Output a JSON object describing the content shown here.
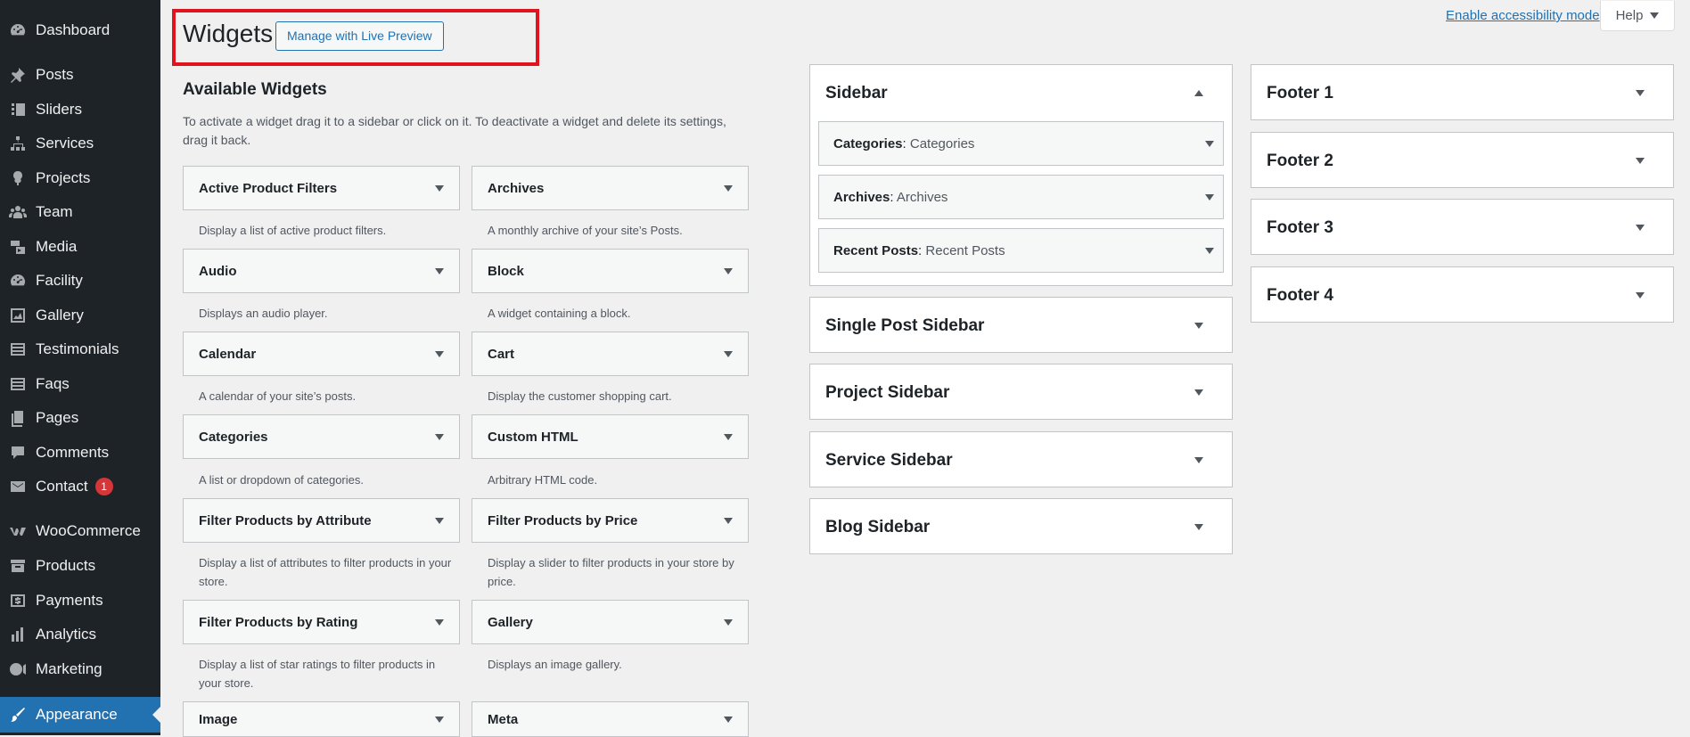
{
  "sidebar": {
    "items": [
      {
        "label": "Dashboard",
        "icon": "dashboard-icon"
      },
      {
        "label": "Posts",
        "icon": "pin-icon"
      },
      {
        "label": "Sliders",
        "icon": "slides-icon"
      },
      {
        "label": "Services",
        "icon": "sitemap-icon"
      },
      {
        "label": "Projects",
        "icon": "tree-icon"
      },
      {
        "label": "Team",
        "icon": "groups-icon"
      },
      {
        "label": "Media",
        "icon": "media-icon"
      },
      {
        "label": "Facility",
        "icon": "dashboard-icon"
      },
      {
        "label": "Gallery",
        "icon": "chart-icon"
      },
      {
        "label": "Testimonials",
        "icon": "list-icon"
      },
      {
        "label": "Faqs",
        "icon": "list-icon"
      },
      {
        "label": "Pages",
        "icon": "pages-icon"
      },
      {
        "label": "Comments",
        "icon": "comment-icon"
      },
      {
        "label": "Contact",
        "icon": "mail-icon",
        "badge": "1"
      },
      {
        "label": "WooCommerce",
        "icon": "woo-icon"
      },
      {
        "label": "Products",
        "icon": "archive-icon"
      },
      {
        "label": "Payments",
        "icon": "dollar-icon"
      },
      {
        "label": "Analytics",
        "icon": "bar-chart-icon"
      },
      {
        "label": "Marketing",
        "icon": "megaphone-icon"
      },
      {
        "label": "Appearance",
        "icon": "brush-icon",
        "current": true
      }
    ]
  },
  "header": {
    "title": "Widgets",
    "live_preview_label": "Manage with Live Preview",
    "accessibility_link": "Enable accessibility mode",
    "help_label": "Help"
  },
  "available": {
    "title": "Available Widgets",
    "description": "To activate a widget drag it to a sidebar or click on it. To deactivate a widget and delete its settings, drag it back.",
    "widgets": [
      {
        "name": "Active Product Filters",
        "desc": "Display a list of active product filters."
      },
      {
        "name": "Archives",
        "desc": "A monthly archive of your site’s Posts."
      },
      {
        "name": "Audio",
        "desc": "Displays an audio player."
      },
      {
        "name": "Block",
        "desc": "A widget containing a block."
      },
      {
        "name": "Calendar",
        "desc": "A calendar of your site’s posts."
      },
      {
        "name": "Cart",
        "desc": "Display the customer shopping cart."
      },
      {
        "name": "Categories",
        "desc": "A list or dropdown of categories."
      },
      {
        "name": "Custom HTML",
        "desc": "Arbitrary HTML code."
      },
      {
        "name": "Filter Products by Attribute",
        "desc": "Display a list of attributes to filter products in your store."
      },
      {
        "name": "Filter Products by Price",
        "desc": "Display a slider to filter products in your store by price."
      },
      {
        "name": "Filter Products by Rating",
        "desc": "Display a list of star ratings to filter products in your store."
      },
      {
        "name": "Gallery",
        "desc": "Displays an image gallery."
      },
      {
        "name": "Image",
        "desc": ""
      },
      {
        "name": "Meta",
        "desc": ""
      }
    ]
  },
  "areas": {
    "sidebar": {
      "title": "Sidebar",
      "widgets": [
        {
          "name": "Categories",
          "sep": ": ",
          "title": "Categories"
        },
        {
          "name": "Archives",
          "sep": ": ",
          "title": "Archives"
        },
        {
          "name": "Recent Posts",
          "sep": ": ",
          "title": "Recent Posts"
        }
      ]
    },
    "single_post": {
      "title": "Single Post Sidebar"
    },
    "project": {
      "title": "Project Sidebar"
    },
    "service": {
      "title": "Service Sidebar"
    },
    "blog": {
      "title": "Blog Sidebar"
    },
    "footer1": {
      "title": "Footer 1"
    },
    "footer2": {
      "title": "Footer 2"
    },
    "footer3": {
      "title": "Footer 3"
    },
    "footer4": {
      "title": "Footer 4"
    }
  },
  "colors": {
    "admin_bg": "#1d2327",
    "accent": "#2271b1",
    "highlight": "#e0141e",
    "badge": "#d63638"
  }
}
